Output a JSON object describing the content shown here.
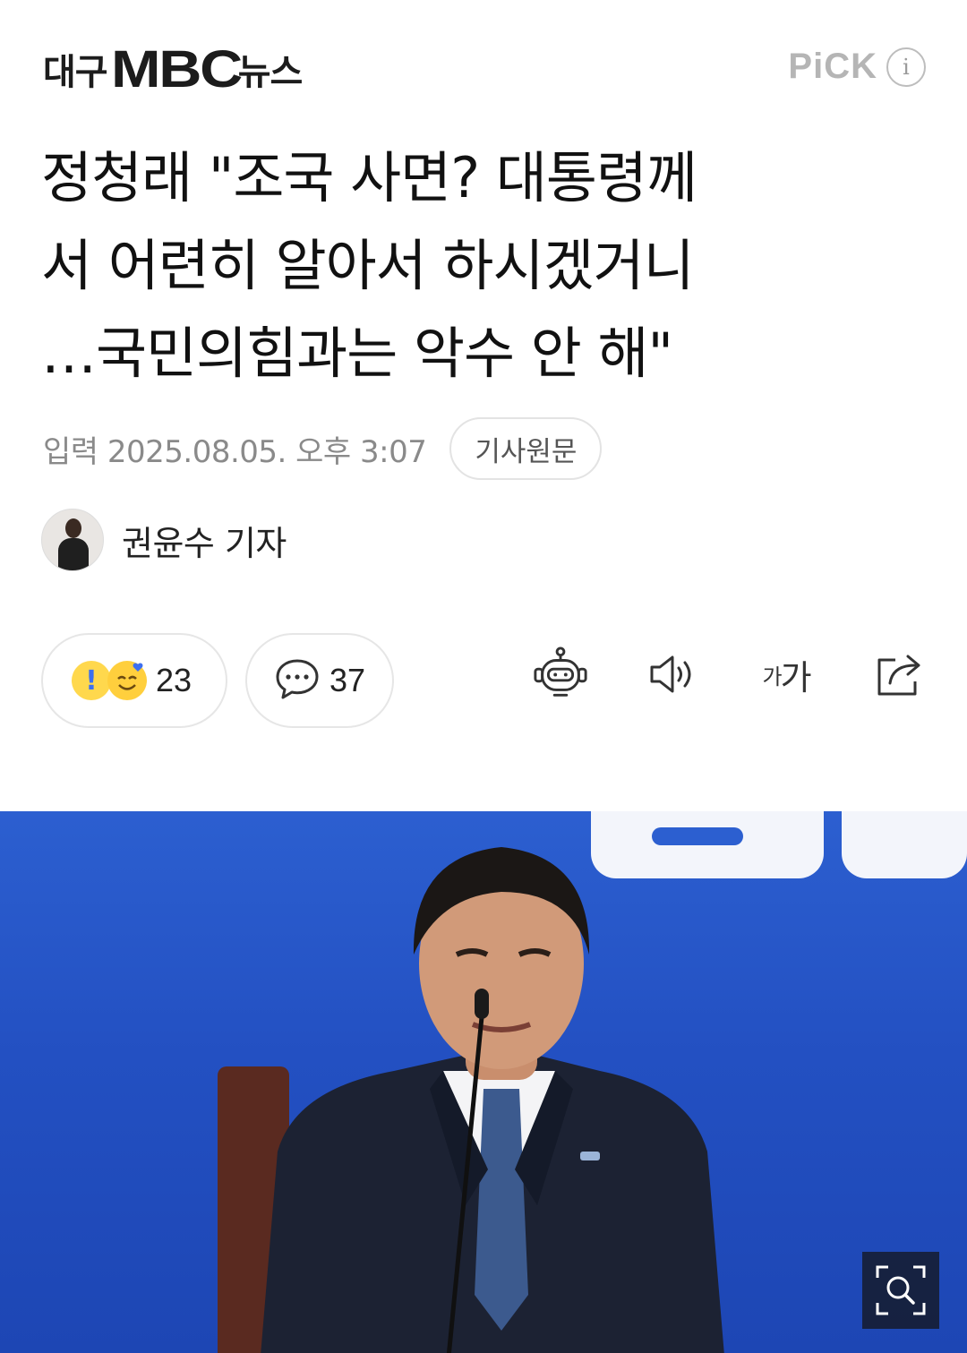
{
  "header": {
    "logo_prefix": "대구",
    "logo_brand": "MBC",
    "logo_suffix": "뉴스",
    "pick_label": "PiCK",
    "info_icon": "i"
  },
  "article": {
    "title_line1": "정청래 \"조국 사면? 대통령께",
    "title_line2": "서 어련히 알아서 하시겠거니",
    "title_line3": "…국민의힘과는 악수 안 해\"",
    "date": "입력 2025.08.05. 오후 3:07",
    "original_button": "기사원문",
    "reporter": "권윤수 기자"
  },
  "actions": {
    "reaction_count": "23",
    "comment_count": "37",
    "font_size_small": "가",
    "font_size_large": "가"
  },
  "icons": {
    "reaction": [
      "exclamation-emoji-icon",
      "smile-heart-emoji-icon"
    ],
    "comment": "speech-bubble-icon",
    "tools": [
      "robot-summary-icon",
      "speaker-icon",
      "font-size-icon",
      "share-icon"
    ],
    "photo": "zoom-search-icon"
  },
  "colors": {
    "background": "#ffffff",
    "text": "#111111",
    "muted": "#8a8a8a",
    "photo_backdrop": "#2350c2"
  }
}
